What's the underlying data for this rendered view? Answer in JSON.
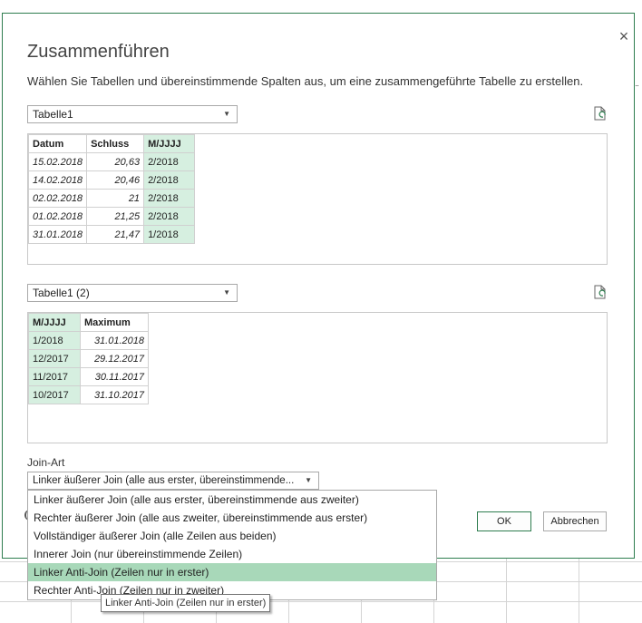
{
  "dialog": {
    "title": "Zusammenführen",
    "subtitle": "Wählen Sie Tabellen und übereinstimmende Spalten aus, um eine zusammengeführte Tabelle zu erstellen.",
    "close_label": "×"
  },
  "table1": {
    "select_value": "Tabelle1",
    "headers": [
      "Datum",
      "Schluss",
      "M/JJJJ"
    ],
    "rows": [
      [
        "15.02.2018",
        "20,63",
        "2/2018"
      ],
      [
        "14.02.2018",
        "20,46",
        "2/2018"
      ],
      [
        "02.02.2018",
        "21",
        "2/2018"
      ],
      [
        "01.02.2018",
        "21,25",
        "2/2018"
      ],
      [
        "31.01.2018",
        "21,47",
        "1/2018"
      ]
    ]
  },
  "table2": {
    "select_value": "Tabelle1 (2)",
    "headers": [
      "M/JJJJ",
      "Maximum"
    ],
    "rows": [
      [
        "1/2018",
        "31.01.2018"
      ],
      [
        "12/2017",
        "29.12.2017"
      ],
      [
        "11/2017",
        "30.11.2017"
      ],
      [
        "10/2017",
        "31.10.2017"
      ]
    ]
  },
  "join": {
    "label": "Join-Art",
    "selected": "Linker äußerer Join (alle aus erster, übereinstimmende...",
    "options": [
      "Linker äußerer Join (alle aus erster, übereinstimmende aus zweiter)",
      "Rechter äußerer Join (alle aus zweiter, übereinstimmende aus erster)",
      "Vollständiger äußerer Join (alle Zeilen aus beiden)",
      "Innerer Join (nur übereinstimmende Zeilen)",
      "Linker Anti-Join (Zeilen nur in erster)",
      "Rechter Anti-Join (Zeilen nur in zweiter)"
    ],
    "highlighted_index": 4,
    "tooltip": "Linker Anti-Join (Zeilen nur in erster)"
  },
  "buttons": {
    "ok": "OK",
    "cancel": "Abbrechen"
  },
  "icons": {
    "refresh": "refresh-icon",
    "dropdown": "chevron-down-icon",
    "close": "close-icon"
  },
  "colors": {
    "accent": "#2e7d4f",
    "selected_column": "#d6efe0",
    "highlight": "#a8d8b9"
  }
}
